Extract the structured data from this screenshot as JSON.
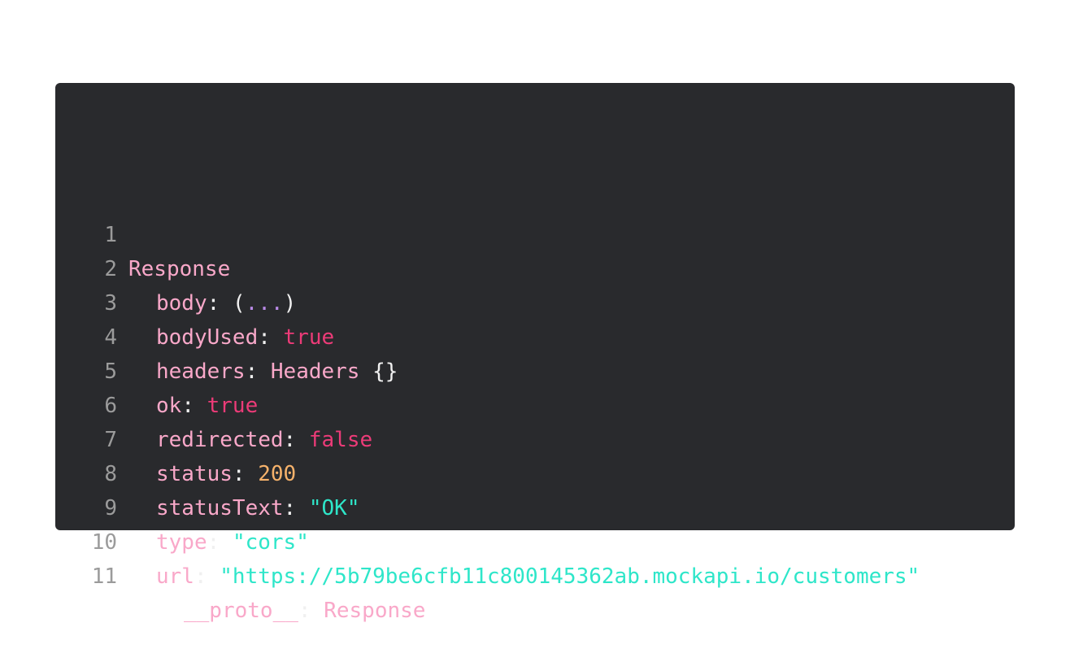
{
  "colors": {
    "background": "#ffffff",
    "code_background": "#292a2d",
    "line_number": "#9b9b9b",
    "key": "#f9a8c9",
    "punctuation": "#f0f0f0",
    "boolean": "#ec3b78",
    "number": "#f6b26b",
    "string": "#2ee6c9",
    "ellipsis": "#b98ae6"
  },
  "code": {
    "lines": [
      {
        "number": "1",
        "class_name": "Response"
      },
      {
        "number": "2",
        "key": "body",
        "sep": ": ",
        "open": "(",
        "ellipsis": "...",
        "close": ")"
      },
      {
        "number": "3",
        "key": "bodyUsed",
        "sep": ": ",
        "value": "true"
      },
      {
        "number": "4",
        "key": "headers",
        "sep": ": ",
        "class_name": "Headers",
        "braces": " {}"
      },
      {
        "number": "5",
        "key": "ok",
        "sep": ": ",
        "value": "true"
      },
      {
        "number": "6",
        "key": "redirected",
        "sep": ": ",
        "value": "false"
      },
      {
        "number": "7",
        "key": "status",
        "sep": ": ",
        "value": "200"
      },
      {
        "number": "8",
        "key": "statusText",
        "sep": ": ",
        "value": "\"OK\""
      },
      {
        "number": "9",
        "key": "type",
        "sep": ": ",
        "value": "\"cors\""
      },
      {
        "number": "10",
        "key": "url",
        "sep": ": ",
        "value": "\"https://5b79be6cfb11c800145362ab.mockapi.io/customers\""
      },
      {
        "number": "11",
        "key": "__proto__",
        "sep": ": ",
        "class_name": "Response"
      }
    ]
  }
}
